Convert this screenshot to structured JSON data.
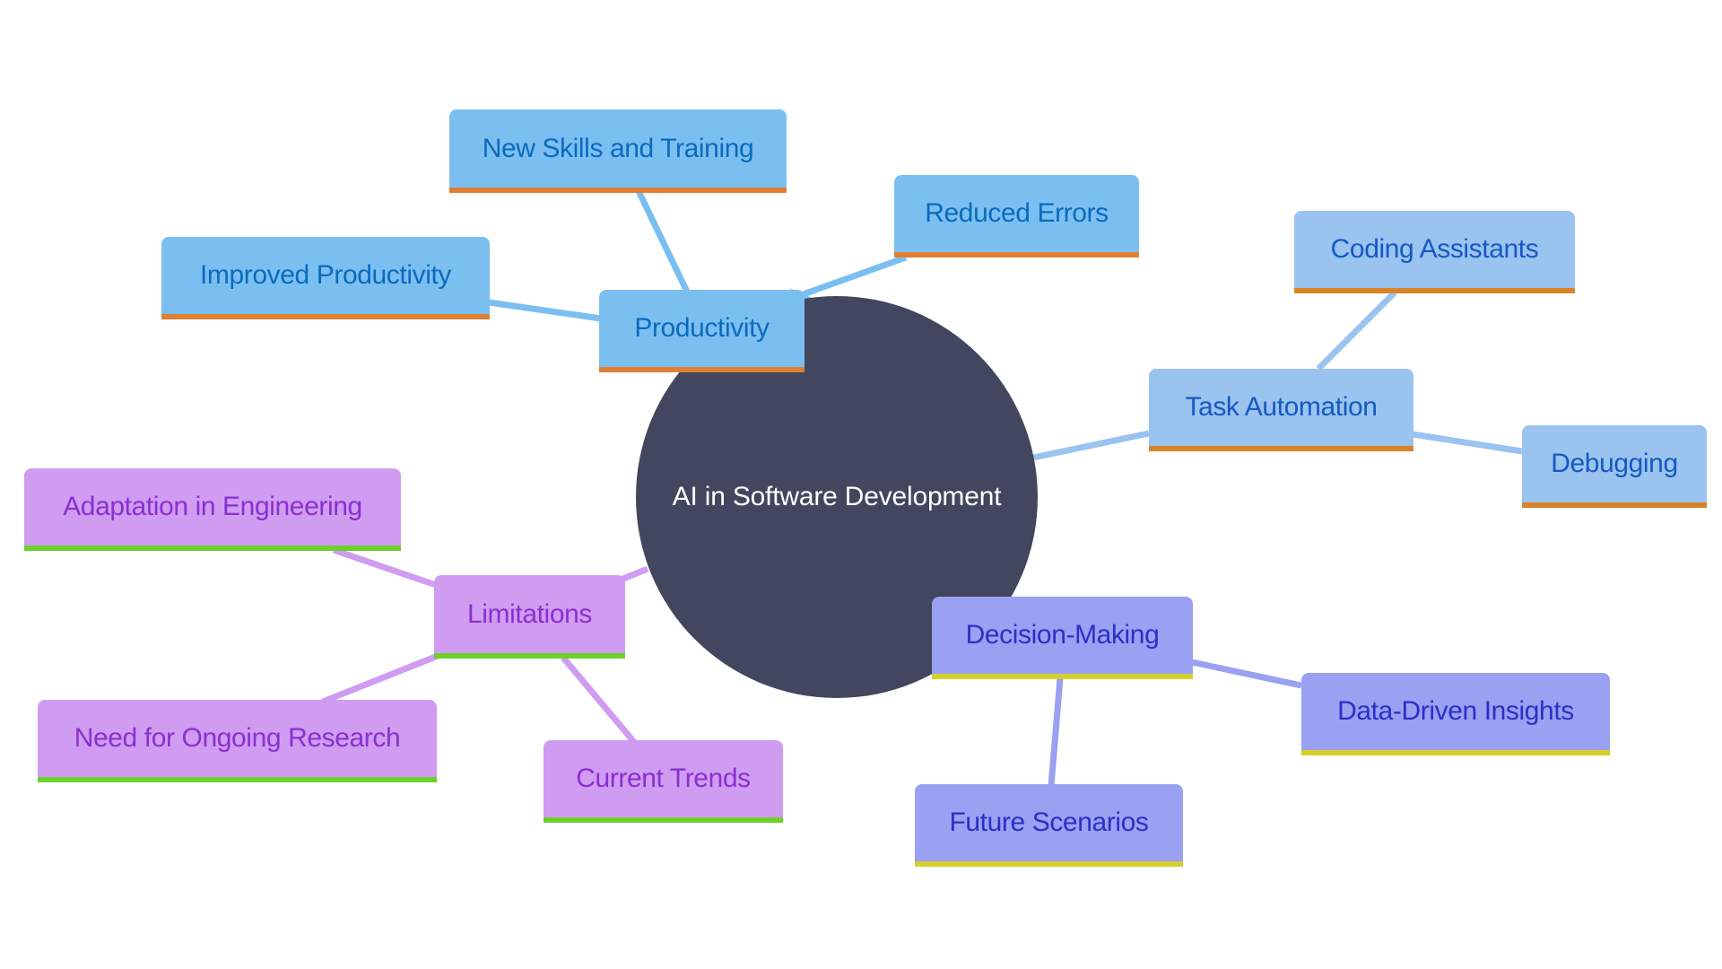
{
  "diagram": {
    "type": "mindmap",
    "root": {
      "label": "AI in Software Development",
      "color": "#42465e"
    },
    "branches": [
      {
        "id": "productivity",
        "label": "Productivity",
        "colors": {
          "fill": "#7bbff1",
          "text": "#0a6bbd",
          "accent": "#e07f33",
          "line": "#7bbff1"
        },
        "children": [
          {
            "id": "new-skills",
            "label": "New Skills and Training"
          },
          {
            "id": "reduced-errors",
            "label": "Reduced Errors"
          },
          {
            "id": "improved-productivity",
            "label": "Improved Productivity"
          }
        ]
      },
      {
        "id": "task-automation",
        "label": "Task Automation",
        "colors": {
          "fill": "#9ac3ef",
          "text": "#1559c4",
          "accent": "#d98328",
          "line": "#9ac3ef"
        },
        "children": [
          {
            "id": "coding-assistants",
            "label": "Coding Assistants"
          },
          {
            "id": "debugging",
            "label": "Debugging"
          }
        ]
      },
      {
        "id": "limitations",
        "label": "Limitations",
        "colors": {
          "fill": "#cf9cf2",
          "text": "#8a2fd0",
          "accent": "#6cd128",
          "line": "#cf9cf2"
        },
        "children": [
          {
            "id": "adaptation",
            "label": "Adaptation in Engineering"
          },
          {
            "id": "ongoing-research",
            "label": "Need for Ongoing Research"
          },
          {
            "id": "current-trends",
            "label": "Current Trends"
          }
        ]
      },
      {
        "id": "decision-making",
        "label": "Decision-Making",
        "colors": {
          "fill": "#9aa0f2",
          "text": "#2c2fc6",
          "accent": "#d6cf2a",
          "line": "#9aa0f2"
        },
        "children": [
          {
            "id": "data-driven",
            "label": "Data-Driven Insights"
          },
          {
            "id": "future-scenarios",
            "label": "Future Scenarios"
          }
        ]
      }
    ]
  }
}
